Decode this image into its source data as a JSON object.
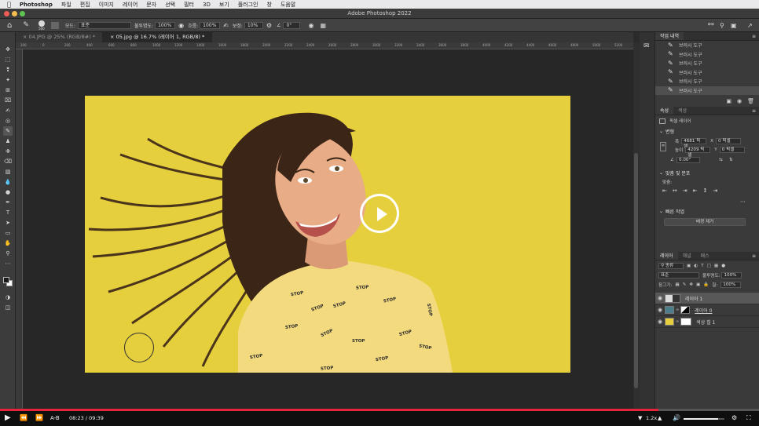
{
  "menubar": {
    "app_name": "Photoshop",
    "items": [
      "파일",
      "편집",
      "이미지",
      "레이어",
      "문자",
      "선택",
      "필터",
      "3D",
      "보기",
      "플러그인",
      "창",
      "도움말"
    ]
  },
  "window": {
    "title": "Adobe Photoshop 2022"
  },
  "options_bar": {
    "brush_size": "500",
    "mode_label": "모드:",
    "mode_value": "표준",
    "opacity_label": "불투명도:",
    "opacity_value": "100%",
    "flow_label": "흐름:",
    "flow_value": "100%",
    "smoothing_label": "보정:",
    "smoothing_value": "10%",
    "angle_value": "0°"
  },
  "tabs": [
    {
      "label": "04.JPG @ 25% (RGB/8#) *",
      "active": false
    },
    {
      "label": "05.jpg @ 16.7% (레이어 1, RGB/8) *",
      "active": true
    }
  ],
  "ruler_ticks": [
    "200",
    "0",
    "200",
    "400",
    "600",
    "800",
    "1000",
    "1200",
    "1400",
    "1600",
    "1800",
    "2000",
    "2200",
    "2400",
    "2600",
    "2800",
    "3000",
    "3200",
    "3400",
    "3600",
    "3800",
    "4000",
    "4200",
    "4400",
    "4600",
    "4800",
    "5000",
    "5200"
  ],
  "shirt_text": [
    "STOP",
    "STOP",
    "STOP",
    "STOP",
    "STOP",
    "STOP",
    "STOP",
    "STOP",
    "STOP",
    "STOP",
    "STOP",
    "STOP",
    "STOP",
    "STOP"
  ],
  "history": {
    "tabs": [
      "작업 내역"
    ],
    "items": [
      "브러시 도구",
      "브러시 도구",
      "브러시 도구",
      "브러시 도구",
      "브러시 도구",
      "브러시 도구"
    ]
  },
  "properties": {
    "tabs": [
      "속성",
      "색상"
    ],
    "layer_type": "픽셀 레이어",
    "transform_title": "변형",
    "w_label": "폭",
    "w_value": "4681 픽셀",
    "x_label": "X",
    "x_value": "0 픽셀",
    "h_label": "높이",
    "h_value": "4209 픽셀",
    "y_label": "Y",
    "y_value": "0 픽셀",
    "angle_value": "0.00°",
    "align_title": "맞춤 및 분포",
    "align_sub": "맞춤:",
    "quick_title": "빠른 작업",
    "quick_button": "배경 제거"
  },
  "layers": {
    "tabs": [
      "레이어",
      "채널",
      "패스"
    ],
    "kind_label": "종류",
    "blend_mode": "표준",
    "opacity_label": "불투명도:",
    "opacity_value": "100%",
    "lock_label": "잠그기:",
    "fill_label": "칠:",
    "fill_value": "100%",
    "items": [
      {
        "name": "레이어 1",
        "selected": true
      },
      {
        "name": "레이어 0",
        "selected": false
      },
      {
        "name": "색상 칠 1",
        "selected": false
      }
    ]
  },
  "player": {
    "ab_label": "A-B",
    "current_time": "08:23",
    "separator": "/",
    "duration": "09:39",
    "speed": "1.2x",
    "progress": 0.868,
    "volume": 0.85
  },
  "colors": {
    "canvas_bg": "#e5cf3c",
    "progress_red": "#e8243d"
  }
}
